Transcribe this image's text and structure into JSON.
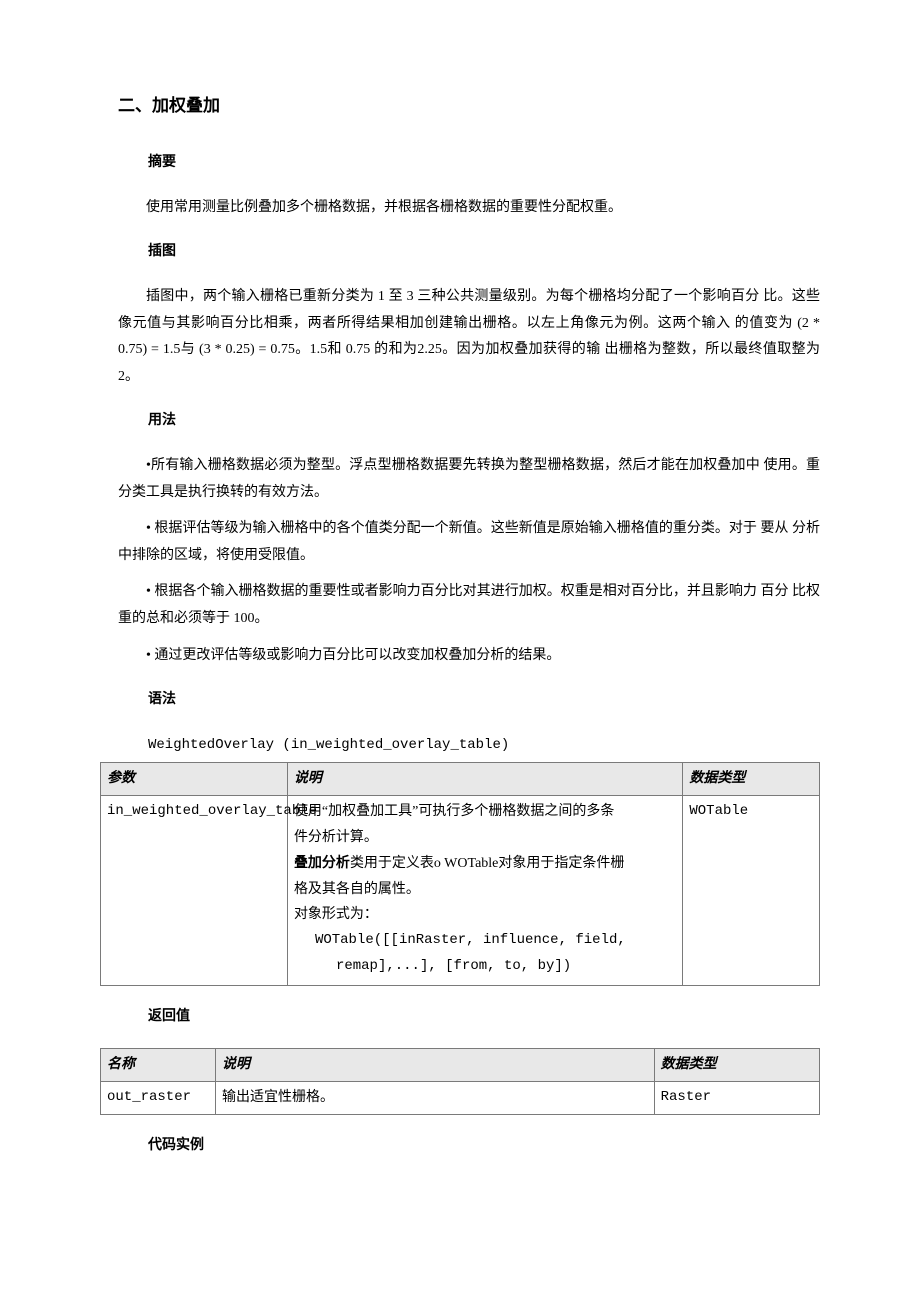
{
  "title": "二、加权叠加",
  "sections": {
    "abstract_h": "摘要",
    "abstract_p": "使用常用测量比例叠加多个栅格数据，并根据各栅格数据的重要性分配权重。",
    "illustration_h": "插图",
    "illustration_p": "插图中，两个输入栅格已重新分类为 1 至 3 三种公共测量级别。为每个栅格均分配了一个影响百分 比。这些像元值与其影响百分比相乘，两者所得结果相加创建输出栅格。以左上角像元为例。这两个输入 的值变为 (2 * 0.75) = 1.5与 (3 * 0.25) = 0.75。1.5和 0.75 的和为2.25。因为加权叠加获得的输 出栅格为整数，所以最终值取整为 2。",
    "usage_h": "用法",
    "usage_b1": "•所有输入栅格数据必须为整型。浮点型栅格数据要先转换为整型栅格数据，然后才能在加权叠加中  使用。重分类工具是执行换转的有效方法。",
    "usage_b2_lead": "• 根据评估等级为输入栅格中的各个值类分配一个新值。这些新值是原始输入栅格值的重分类。对于 要从",
    "usage_b2_cont": "分析中排除的区域，将使用受限值。",
    "usage_b3_lead": "• 根据各个输入栅格数据的重要性或者影响力百分比对其进行加权。权重是相对百分比，并且影响力 百分",
    "usage_b3_cont": "比权重的总和必须等于 100。",
    "usage_b4": "• 通过更改评估等级或影响力百分比可以改变加权叠加分析的结果。",
    "syntax_h": "语法",
    "syntax_line": "WeightedOverlay (in_weighted_overlay_table)",
    "table1": {
      "h1": "参数",
      "h2": "说明",
      "h3": "数据类型",
      "r1c1": "in_weighted_overlay_table",
      "r1c2_l1a": "使用“加权叠加工具”可执行多个栅格数据之间的多条",
      "r1c2_l1b": "件分析计算。",
      "r1c2_l2a_bold": "叠加分析",
      "r1c2_l2a_rest": "类用于定义表o WOTable对象用于指定条件栅",
      "r1c2_l2b": "格及其各自的属性。",
      "r1c2_l3": "对象形式为：",
      "r1c2_l4": "WOTable([[inRaster, influence, field,",
      "r1c2_l5": "remap],...], [from, to, by])",
      "r1c3": "WOTable"
    },
    "return_h": "返回值",
    "table2": {
      "h1": "名称",
      "h2": "说明",
      "h3": "数据类型",
      "r1c1": "out_raster",
      "r1c2": "输出适宜性栅格。",
      "r1c3": "Raster"
    },
    "code_h": "代码实例"
  }
}
